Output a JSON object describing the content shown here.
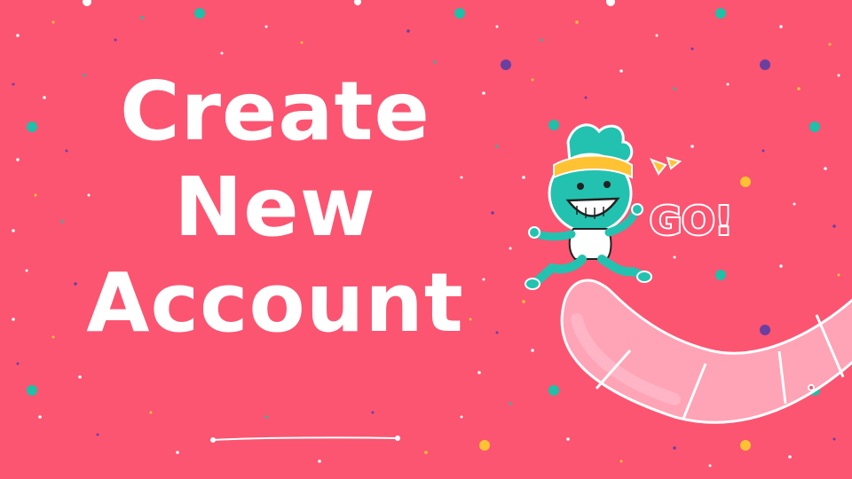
{
  "slide": {
    "title_lines": [
      "Create",
      "New",
      "Account"
    ],
    "go_label": "GO!"
  },
  "colors": {
    "background": "#fb5571",
    "title_text": "#ffffff",
    "confetti_teal": "#1fbfa8",
    "confetti_purple": "#6b3fa0",
    "confetti_yellow": "#ffc233",
    "path_fill": "#ffa3b6",
    "character_body": "#23c2b0",
    "headband": "#ffc233"
  },
  "icons": [
    "running-mascot-icon",
    "go-sticker-icon",
    "winding-path-icon"
  ]
}
